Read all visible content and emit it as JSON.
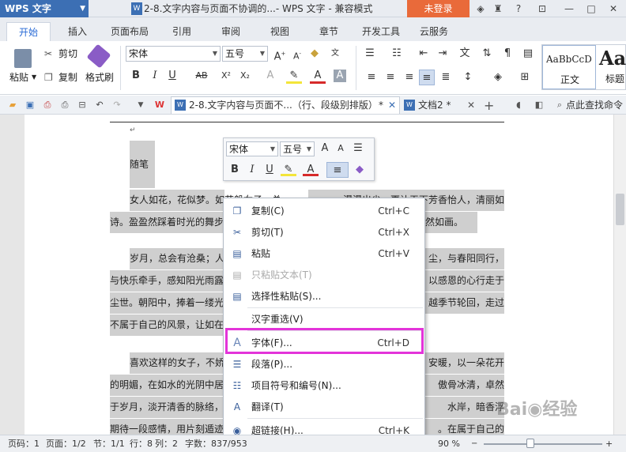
{
  "titlebar": {
    "app_label": "WPS 文字",
    "doc_title": "2-8.文字内容与页面不协调的...- WPS 文字 - 兼容模式",
    "login_label": "未登录"
  },
  "tabs": [
    "开始",
    "插入",
    "页面布局",
    "引用",
    "审阅",
    "视图",
    "章节",
    "开发工具",
    "云服务"
  ],
  "ribbon": {
    "paste": "粘贴",
    "cut": "剪切",
    "copy": "复制",
    "format_painter": "格式刷",
    "font_name": "宋体",
    "font_size": "五号",
    "style_preview": "AaBbCcD",
    "style_name": "正文",
    "style_preview2": "Aa",
    "style_name2": "标题"
  },
  "quickbar": {
    "doc_tab1": "2-8.文字内容与页面不...（行、段级别排版）",
    "doc_tab1_mark": "*",
    "doc_tab2": "文档2",
    "doc_tab2_mark": "*",
    "search": "点此查找命令"
  },
  "document": {
    "title_line": "随笔",
    "lines": [
      "女人如花，花似梦。如花般女子，总",
      "诗。盈盈然踩着时光的舞步",
      "岁月，总会有沧桑；人",
      "与快乐牵手，感知阳光雨露",
      "尘世。朝阳中，捧着一缕光",
      "不属于自己的风景，让如在",
      "喜欢这样的女子，不娇",
      "的明媚，在如水的光阴中居",
      "于岁月，淡开清香的脉络，",
      "期待一段感情，用片刻遁迹"
    ],
    "right_lines": [
      "漫漫出尘，更让天下芳香怡人，清丽如",
      "然如画。",
      "尘，与春阳同行，",
      "以感恩的心行走于",
      "越季节轮回，走过",
      "安暖，以一朵花开",
      "傲骨冰清，卓然",
      "水岸，暗香浮",
      "。在属于自己的"
    ]
  },
  "mini_toolbar": {
    "font": "宋体",
    "size": "五号"
  },
  "context_menu": [
    {
      "label": "复制(C)",
      "shortcut": "Ctrl+C",
      "icon": "copy-icon",
      "disabled": false
    },
    {
      "label": "剪切(T)",
      "shortcut": "Ctrl+X",
      "icon": "scissors-icon",
      "disabled": false
    },
    {
      "label": "粘贴",
      "shortcut": "Ctrl+V",
      "icon": "paste-icon",
      "disabled": false
    },
    {
      "label": "只粘贴文本(T)",
      "shortcut": "",
      "icon": "paste-text-icon",
      "disabled": true
    },
    {
      "label": "选择性粘贴(S)...",
      "shortcut": "",
      "icon": "paste-special-icon",
      "disabled": false
    },
    {
      "label": "汉字重选(V)",
      "shortcut": "",
      "icon": "",
      "disabled": false
    },
    {
      "label": "字体(F)...",
      "shortcut": "Ctrl+D",
      "icon": "font-icon",
      "disabled": false
    },
    {
      "label": "段落(P)...",
      "shortcut": "",
      "icon": "paragraph-icon",
      "disabled": false
    },
    {
      "label": "项目符号和编号(N)...",
      "shortcut": "",
      "icon": "bullets-icon",
      "disabled": false
    },
    {
      "label": "翻译(T)",
      "shortcut": "",
      "icon": "translate-icon",
      "disabled": false
    },
    {
      "label": "超链接(H)...",
      "shortcut": "Ctrl+K",
      "icon": "hyperlink-icon",
      "disabled": false
    }
  ],
  "status": {
    "page_code": "页码：1",
    "page": "页面：1/2",
    "section": "节：1/1",
    "row": "行：8",
    "col": "列：2",
    "words": "字数：837/953",
    "zoom": "90 %"
  },
  "colors": {
    "accent": "#2a6bd6",
    "wps_blue": "#3c6fb4",
    "login_orange": "#e96a3a",
    "highlight_box": "#e334d9",
    "selection_gray": "#cfcfcf"
  }
}
